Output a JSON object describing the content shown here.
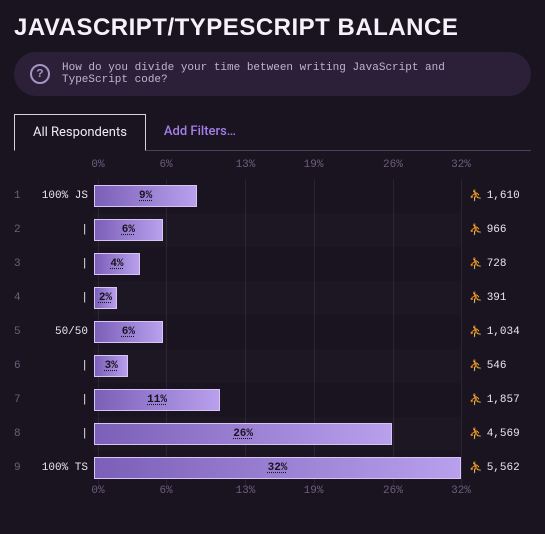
{
  "title": "JAVASCRIPT/TYPESCRIPT BALANCE",
  "question": "How do you divide your time between writing JavaScript and TypeScript code?",
  "tabs": {
    "all": "All Respondents",
    "add": "Add Filters…"
  },
  "axis_ticks": [
    "0%",
    "6%",
    "13%",
    "19%",
    "26%",
    "32%"
  ],
  "axis_max": 32,
  "chart_data": {
    "type": "bar",
    "title": "JavaScript/TypeScript Balance",
    "xlabel": "",
    "ylabel": "",
    "xlim": [
      0,
      32
    ],
    "categories": [
      "100% JS",
      "|",
      "|",
      "|",
      "50/50",
      "|",
      "|",
      "|",
      "100% TS"
    ],
    "series": [
      {
        "name": "percent",
        "values": [
          9,
          6,
          4,
          2,
          6,
          3,
          11,
          26,
          32
        ]
      },
      {
        "name": "count",
        "values": [
          1610,
          966,
          728,
          391,
          1034,
          546,
          1857,
          4569,
          5562
        ]
      }
    ],
    "rows": [
      {
        "idx": "1",
        "label": "100% JS",
        "pct": 9,
        "pct_label": "9%",
        "count": "1,610"
      },
      {
        "idx": "2",
        "label": "|",
        "pct": 6,
        "pct_label": "6%",
        "count": "966"
      },
      {
        "idx": "3",
        "label": "|",
        "pct": 4,
        "pct_label": "4%",
        "count": "728"
      },
      {
        "idx": "4",
        "label": "|",
        "pct": 2,
        "pct_label": "2%",
        "count": "391"
      },
      {
        "idx": "5",
        "label": "50/50",
        "pct": 6,
        "pct_label": "6%",
        "count": "1,034"
      },
      {
        "idx": "6",
        "label": "|",
        "pct": 3,
        "pct_label": "3%",
        "count": "546"
      },
      {
        "idx": "7",
        "label": "|",
        "pct": 11,
        "pct_label": "11%",
        "count": "1,857"
      },
      {
        "idx": "8",
        "label": "|",
        "pct": 26,
        "pct_label": "26%",
        "count": "4,569"
      },
      {
        "idx": "9",
        "label": "100% TS",
        "pct": 32,
        "pct_label": "32%",
        "count": "5,562"
      }
    ]
  }
}
